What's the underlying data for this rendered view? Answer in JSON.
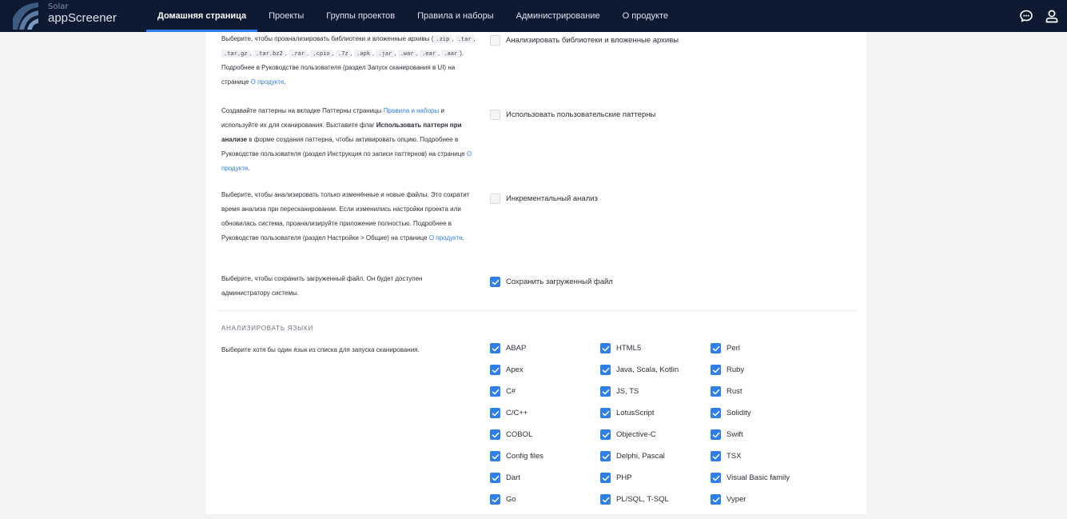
{
  "app": {
    "brand_top": "Solar",
    "brand_name": "appScreener"
  },
  "nav": {
    "items": [
      {
        "label": "Домашняя страница",
        "active": true
      },
      {
        "label": "Проекты"
      },
      {
        "label": "Группы проектов"
      },
      {
        "label": "Правила и наборы"
      },
      {
        "label": "Администрирование"
      },
      {
        "label": "О продукте"
      }
    ],
    "icons": [
      "chat-icon",
      "user-icon"
    ]
  },
  "settings": {
    "libs": {
      "desc_1": "Выберите, чтобы проанализировать библиотеки и вложенные архивы (",
      "ext": [
        ".zip",
        ".tar",
        ".tar.gz",
        ".tar.bz2",
        ".rar",
        ".cpio",
        ".7z",
        ".apk",
        ".jar",
        ".war",
        ".ear",
        ".aar"
      ],
      "desc_2": "). Подробнее в Руководстве пользователя (раздел Запуск сканирования в UI) на странице ",
      "link": "О продукте",
      "desc_end": ".",
      "option": "Анализировать библиотеки и вложенные архивы",
      "checked": false
    },
    "patterns": {
      "desc_1": "Создавайте паттерны на вкладке Паттерны страницы ",
      "link_1": "Правила и наборы",
      "desc_2": " и используйте их для сканирования. Выставите флаг ",
      "bold": "Использовать паттерн при анализе",
      "desc_3": " в форме создания паттерна, чтобы активировать опцию. Подробнее в Руководстве пользователя (раздел Инструкция по записи паттернов) на странице ",
      "link_2": "О продукте",
      "desc_end": ".",
      "option": "Использовать пользовательские паттерны",
      "checked": false
    },
    "incremental": {
      "desc_1": "Выберите, чтобы анализировать только изменённые и новые файлы. Это сократит время анализа при пересканировании. Если изменились настройки проекта или обновилась система, проанализируйте приложение полностью. Подробнее в Руководстве пользователя (раздел Настройки > Общие) на странице ",
      "link": "О продукте",
      "desc_end": ".",
      "option": "Инкрементальный анализ",
      "checked": false
    },
    "save_file": {
      "desc": "Выберите, чтобы сохранить загруженный файл. Он будет доступен администратору системы.",
      "option": "Сохранить загруженный файл",
      "checked": true
    }
  },
  "languages": {
    "title": "АНАЛИЗИРОВАТЬ ЯЗЫКИ",
    "desc": "Выберите хотя бы один язык из списка для запуска сканирования.",
    "columns": [
      [
        "ABAP",
        "Apex",
        "C#",
        "C/C++",
        "COBOL",
        "Config files",
        "Dart",
        "Go"
      ],
      [
        "HTML5",
        "Java, Scala, Kotlin",
        "JS, TS",
        "LotusScript",
        "Objective-C",
        "Delphi, Pascal",
        "PHP",
        "PL/SQL, T-SQL"
      ],
      [
        "Perl",
        "Ruby",
        "Rust",
        "Solidity",
        "Swift",
        "TSX",
        "Visual Basic family",
        "Vyper"
      ]
    ]
  },
  "colors": {
    "topbar": "#0d1a31",
    "accent": "#2f7fe8",
    "background": "#f2f3f5"
  }
}
